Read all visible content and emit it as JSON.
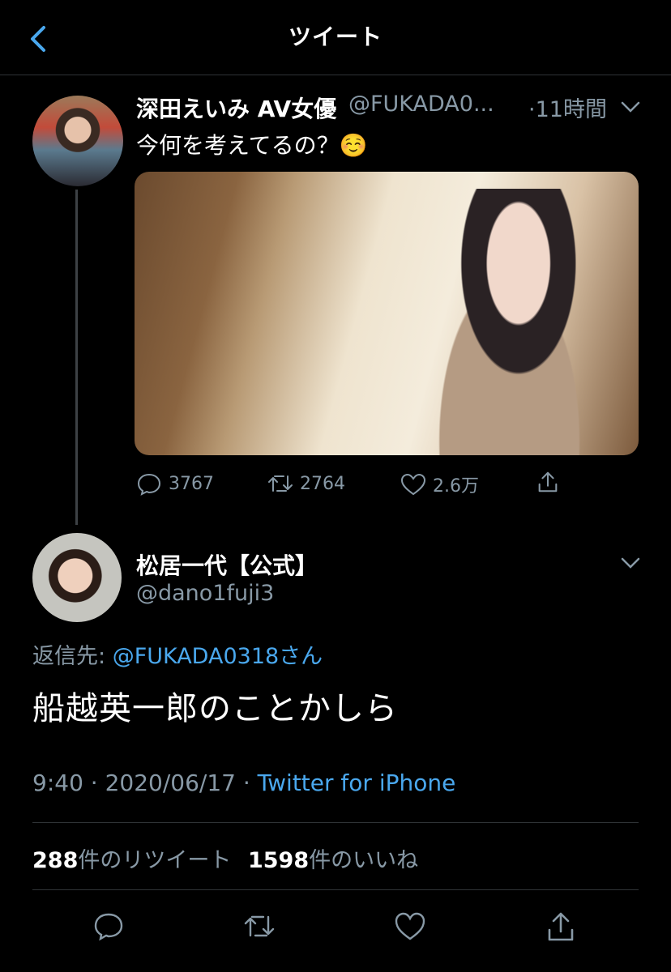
{
  "header": {
    "title": "ツイート",
    "back_icon": "chevron-left-icon"
  },
  "tweet": {
    "name": "深田えいみ AV女優",
    "handle": "@FUKADA0...",
    "time": "·11時間",
    "text": "今何を考えてるの？☺️",
    "actions": {
      "replies": "3767",
      "retweets": "2764",
      "likes": "2.6万"
    }
  },
  "reply": {
    "name": "松居一代【公式】",
    "handle": "@dano1fuji3",
    "reply_to_prefix": "返信先: ",
    "reply_to_handle": "@FUKADA0318さん",
    "text": "船越英一郎のことかしら",
    "time": "9:40 · 2020/06/17 · ",
    "source": "Twitter for iPhone",
    "retweet_count": "288",
    "retweet_label": "件のリツイート",
    "like_count": "1598",
    "like_label": "件のいいね"
  },
  "colors": {
    "background": "#000000",
    "link": "#4aa8ee",
    "muted": "#8899a6",
    "divider": "#2f3336"
  }
}
